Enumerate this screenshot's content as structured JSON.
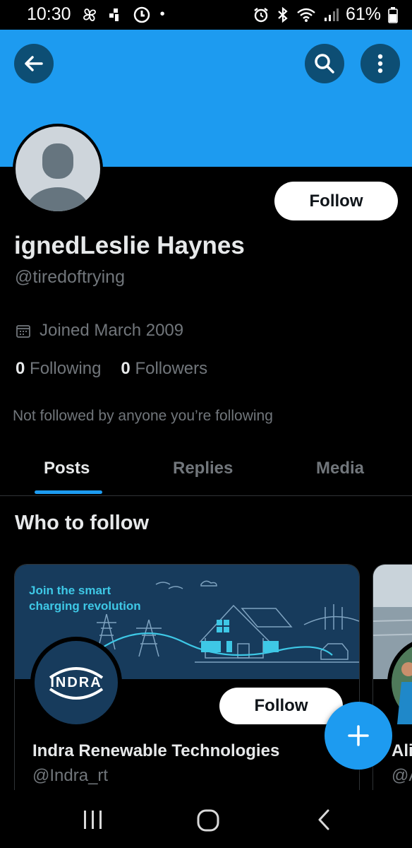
{
  "status_bar": {
    "time": "10:30",
    "battery": "61%"
  },
  "header": {
    "back_icon": "arrow-left-icon",
    "search_icon": "search-icon",
    "more_icon": "more-vertical-icon"
  },
  "profile": {
    "follow_label": "Follow",
    "display_name": "ignedLeslie Haynes",
    "handle": "@tiredoftrying",
    "joined": "Joined March 2009",
    "following_count": "0",
    "following_label": "Following",
    "followers_count": "0",
    "followers_label": "Followers",
    "not_followed_text": "Not followed by anyone you’re following"
  },
  "tabs": [
    {
      "label": "Posts",
      "active": true
    },
    {
      "label": "Replies",
      "active": false
    },
    {
      "label": "Media",
      "active": false
    }
  ],
  "who_to_follow": {
    "title": "Who to follow",
    "cards": [
      {
        "banner_text_line1": "Join the smart",
        "banner_text_line2": "charging revolution",
        "logo_text": "INDRA",
        "name": "Indra Renewable Technologies",
        "handle": "@Indra_rt",
        "follow_label": "Follow"
      },
      {
        "name": "Ali",
        "handle": "@A"
      }
    ]
  },
  "colors": {
    "accent": "#1d9bf0",
    "background": "#000000",
    "secondary_text": "#71767b",
    "primary_text": "#e7e9ea"
  }
}
